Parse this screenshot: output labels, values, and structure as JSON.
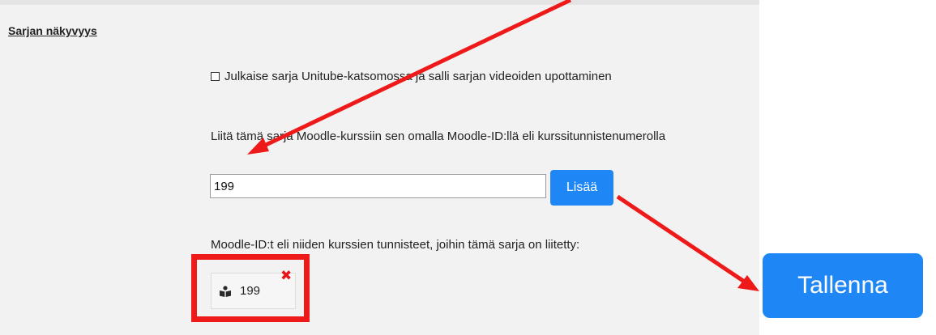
{
  "section": {
    "heading": "Sarjan näkyvyys"
  },
  "publish": {
    "label": "Julkaise sarja Unitube-katsomossa ja salli sarjan videoiden upottaminen",
    "checked": false
  },
  "moodle": {
    "help_text": "Liitä tämä sarja Moodle-kurssiin sen omalla Moodle-ID:llä eli kurssitunnistenumerolla",
    "input_value": "199",
    "add_label": "Lisää",
    "linked_label": "Moodle-ID:t eli niiden kurssien tunnisteet, joihin tämä sarja on liitetty:",
    "linked_ids": [
      {
        "id": "199",
        "icon": "course-icon",
        "remove_icon": "remove-icon"
      }
    ]
  },
  "save_label": "Tallenna",
  "colors": {
    "accent": "#1f87f5",
    "annotation_red": "#ee1a1a",
    "remove": "#e4161b"
  }
}
